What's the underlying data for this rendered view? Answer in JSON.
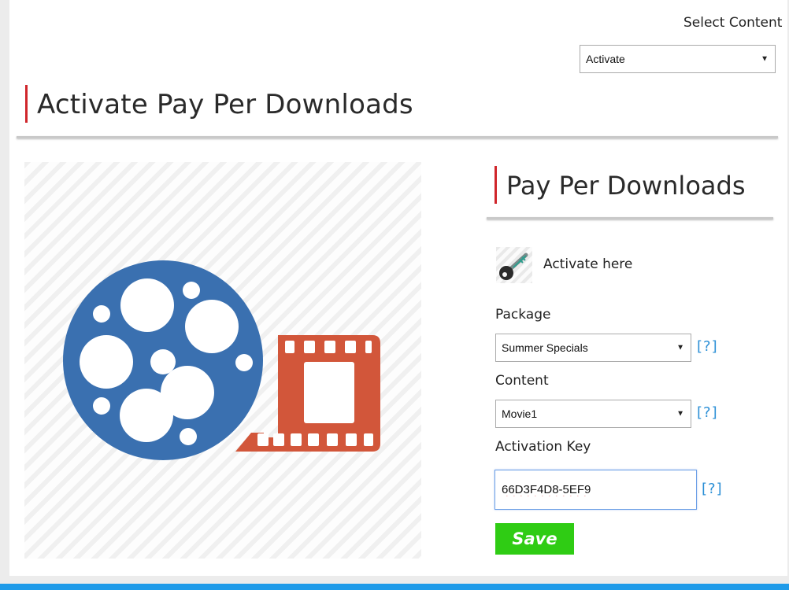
{
  "header": {
    "select_content_label": "Select Content",
    "select_content_value": "Activate"
  },
  "page": {
    "title": "Activate Pay Per Downloads"
  },
  "illustration": {
    "name": "film-reel-icon",
    "colors": {
      "reel": "#3a70b0",
      "film": "#d2563a"
    }
  },
  "form": {
    "title": "Pay Per Downloads",
    "activate_text": "Activate here",
    "package_label": "Package",
    "package_value": "Summer Specials",
    "content_label": "Content",
    "content_value": "Movie1",
    "activation_key_label": "Activation Key",
    "activation_key_value": "66D3F4D8-5EF9",
    "help_text": "[?]",
    "save_label": "Save"
  },
  "colors": {
    "accent_red": "#d0262b",
    "save_green": "#2fcc14",
    "help_blue": "#2b8fd6",
    "bottom_bar": "#1f9be9"
  }
}
